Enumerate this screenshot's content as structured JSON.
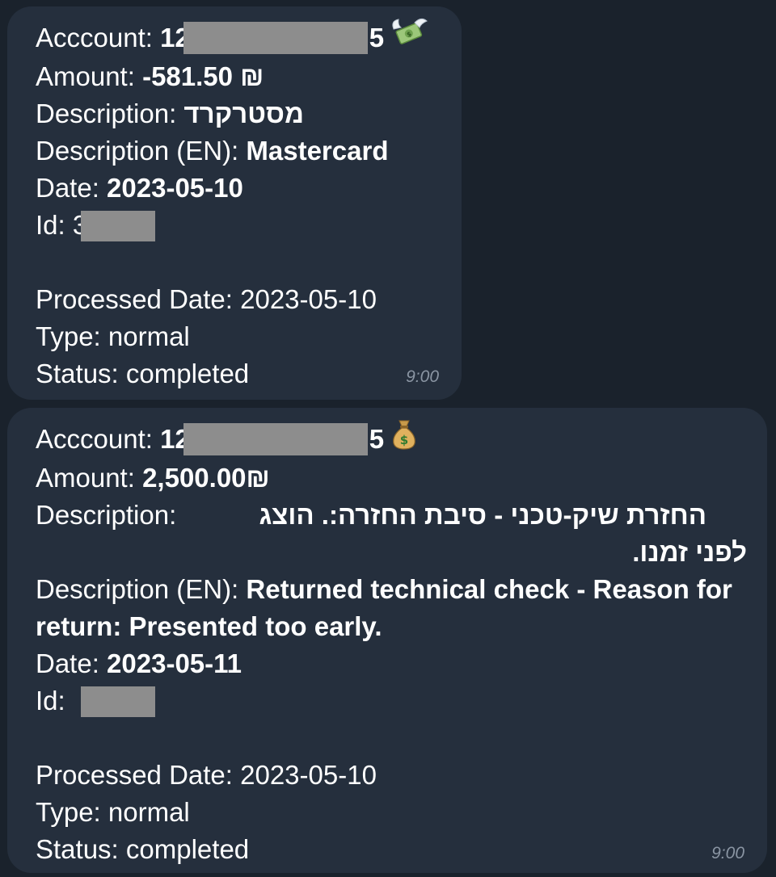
{
  "messages": [
    {
      "account_label": "Acccount: ",
      "account_prefix": "12",
      "account_suffix": "5",
      "emoji": "money-with-wings",
      "amount_label": "Amount: ",
      "amount_value": "-581.50 ₪",
      "description_label": "Description: ",
      "description_value": "מסטרקרד",
      "description_en_label": "Description (EN): ",
      "description_en_value": "Mastercard",
      "date_label": "Date: ",
      "date_value": "2023-05-10",
      "id_label": "Id: ",
      "id_prefix": "3",
      "processed_date_text": "Processed Date: 2023-05-10",
      "type_text": "Type: normal",
      "status_text": "Status: completed",
      "time": "9:00"
    },
    {
      "account_label": "Acccount: ",
      "account_prefix": "12",
      "account_suffix": "5",
      "emoji": "money-bag",
      "amount_label": "Amount:  ",
      "amount_value": "2,500.00₪",
      "description_label": "Description: ",
      "description_value_line1": "החזרת שיק-טכני - סיבת החזרה:. הוצג",
      "description_value_line2": "לפני זמנו.",
      "description_en_label": "Description (EN): ",
      "description_en_value": "Returned technical check - Reason for return: Presented too early.",
      "date_label": "Date: ",
      "date_value": "2023-05-11",
      "id_label": "Id: ",
      "id_prefix": "",
      "processed_date_text": "Processed Date: 2023-05-10",
      "type_text": "Type: normal",
      "status_text": "Status: completed",
      "time": "9:00"
    }
  ],
  "colors": {
    "background": "#1a222c",
    "bubble": "#252f3d",
    "text": "#ffffff",
    "timestamp": "#8a95a3",
    "redaction": "#8d8d8d"
  }
}
